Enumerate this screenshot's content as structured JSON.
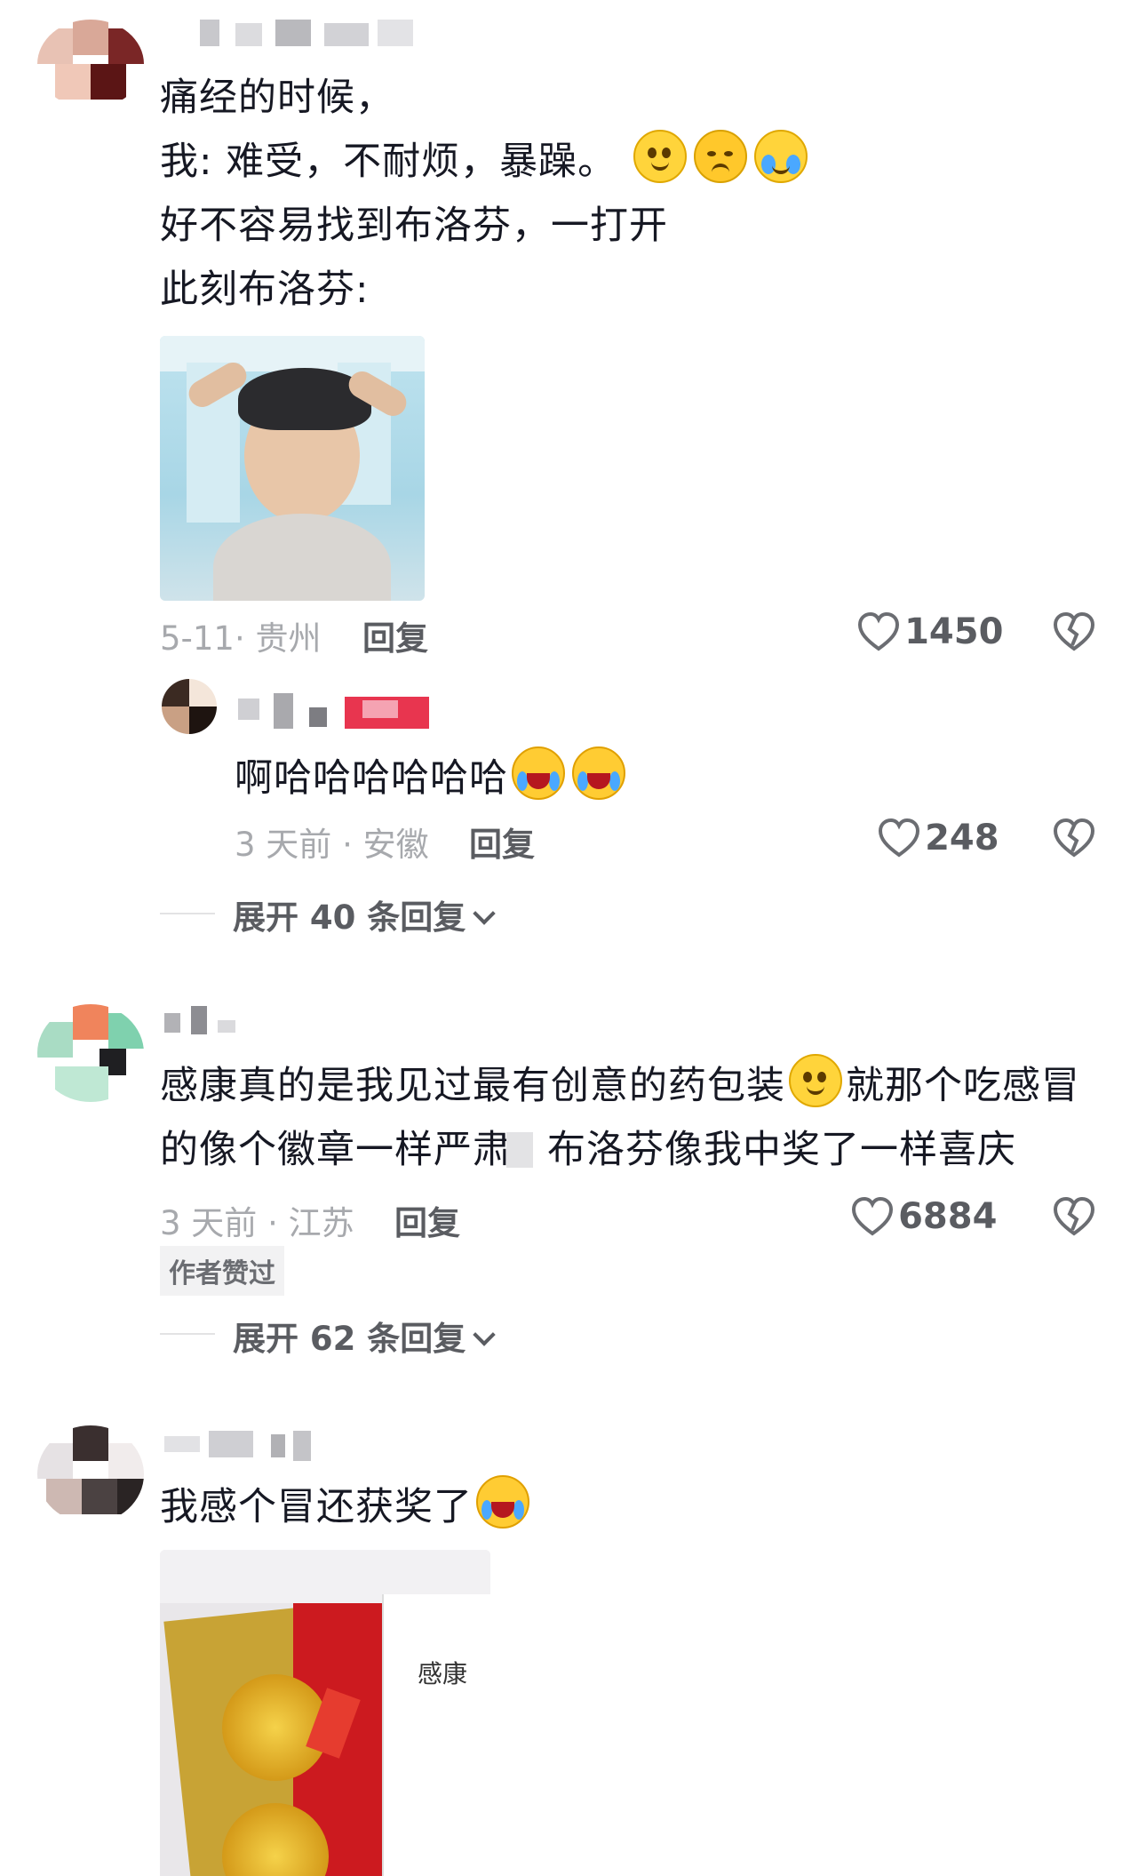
{
  "comments": [
    {
      "lines": [
        "痛经的时候，",
        "我: 难受，不耐烦，暴躁。",
        "好不容易找到布洛芬，一打开",
        "此刻布洛芬:"
      ],
      "date_loc": "5-11· 贵州",
      "reply_label": "回复",
      "likes": "1450",
      "reply": {
        "text": "啊哈哈哈哈哈哈",
        "date_loc": "3 天前 · 安徽",
        "reply_label": "回复",
        "likes": "248"
      },
      "expand_label": "展开 40 条回复"
    },
    {
      "line1": "感康真的是我见过最有创意的药包装",
      "line1_tail": "就那个吃感冒",
      "line2": "的像个徽章一样严肃",
      "line2_tail": "布洛芬像我中奖了一样喜庆",
      "date_loc": "3 天前 · 江苏",
      "reply_label": "回复",
      "likes": "6884",
      "author_tag": "作者赞过",
      "expand_label": "展开 62 条回复"
    },
    {
      "text": "我感个冒还获奖了",
      "image_text": "感康"
    }
  ],
  "icons": {
    "like": "heart-outline-icon",
    "dislike": "broken-heart-icon",
    "expand": "chevron-down-icon"
  },
  "colors": {
    "text": "#161823",
    "meta": "#a7a9ad",
    "action": "#5a5c61"
  }
}
